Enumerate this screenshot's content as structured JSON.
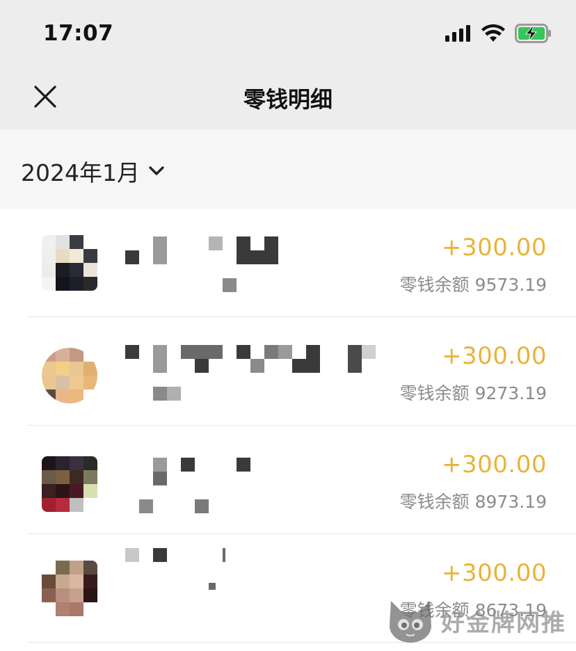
{
  "status_bar": {
    "time": "17:07",
    "battery_icon": "battery-charging-icon",
    "wifi_icon": "wifi-icon",
    "signal_icon": "cellular-signal-icon"
  },
  "nav": {
    "title": "零钱明细",
    "close_icon": "close-icon"
  },
  "filter": {
    "month": "2024年1月",
    "dropdown_icon": "chevron-down-icon"
  },
  "colors": {
    "amount": "#e9b33a",
    "background": "#ededed",
    "filter_background": "#f6f6f6",
    "muted_text": "#8b8b8b"
  },
  "transactions": [
    {
      "amount": "+300.00",
      "balance_label": "零钱余额",
      "balance": "9573.19"
    },
    {
      "amount": "+300.00",
      "balance_label": "零钱余额",
      "balance": "9273.19"
    },
    {
      "amount": "+300.00",
      "balance_label": "零钱余额",
      "balance": "8973.19"
    },
    {
      "amount": "+300.00",
      "balance_label": "零钱余额",
      "balance": "8673.19"
    }
  ],
  "watermark": {
    "text": "好金牌网推",
    "icon": "cat-logo-icon"
  }
}
